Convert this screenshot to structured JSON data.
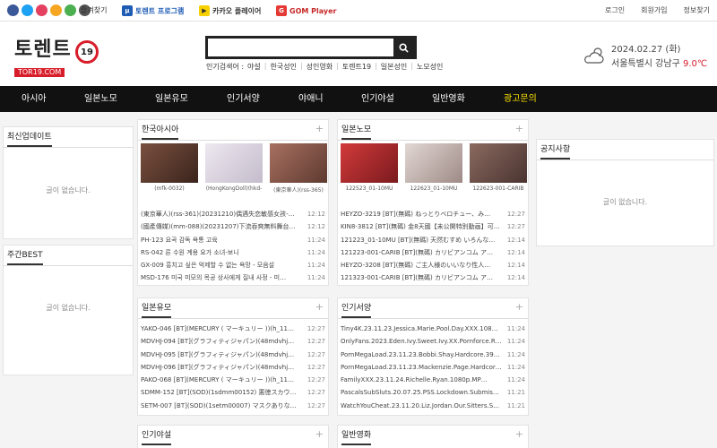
{
  "topbar": {
    "social_colors": [
      "#3b5998",
      "#1da1f2",
      "#e4405f",
      "#f5a623",
      "#4caf50",
      "#555555"
    ],
    "favorite": "즐겨찾기",
    "torrent_program": "토렌트 프로그램",
    "kakao_player": "카카오 플레이어",
    "gom_player": "GOM Player",
    "links": [
      "로그인",
      "회원가입",
      "정보찾기"
    ]
  },
  "header": {
    "logo_main": "토렌트",
    "logo_sub": "TOR19.COM",
    "logo_badge": "19",
    "search_placeholder": "",
    "keywords_label": "인기검색어 :",
    "keywords": [
      "야설",
      "한국성인",
      "성인영화",
      "토렌트19",
      "일본성인",
      "노모성인"
    ],
    "weather_date": "2024.02.27 (화)",
    "weather_location": "서울특별시 강남구",
    "weather_temp": "9.0℃"
  },
  "nav": [
    "아시아",
    "일본노모",
    "일본유모",
    "인기서양",
    "야애니",
    "인기야설",
    "일반영화",
    "광고문의"
  ],
  "left": {
    "latest_title": "최신업데이트",
    "latest_empty": "글이 없습니다.",
    "weekly_title": "주간BEST",
    "weekly_empty": "글이 없습니다."
  },
  "right": {
    "notice_title": "공지사항",
    "notice_empty": "글이 없습니다."
  },
  "sections": {
    "korea_asia": {
      "title": "한국아시아",
      "thumb_colors": [
        "#5a3b2e",
        "#d9d2dd",
        "#8a5a4b"
      ],
      "thumb_captions": [
        "(mfk-0032)",
        "(HongKongDoll)(hkd-",
        "(東京華人)(rss-365)"
      ],
      "items": [
        {
          "title": "(東京華人)(rss-361)(20231210)偶遇失恋敏感女孩-…",
          "time": "12:12"
        },
        {
          "title": "(國產傳媒)(mm-088)(20231207)下流吞爽無料舞台…",
          "time": "12:12"
        },
        {
          "title": "PH-123 요곡 감독 욕통 고육",
          "time": "11:24"
        },
        {
          "title": "RS-042 른 수원 계용 요가 소녀-보니",
          "time": "11:24"
        },
        {
          "title": "GX-009 흥치고 싶은 억제할 수 없는 욕망 - 모음설",
          "time": "11:24"
        },
        {
          "title": "MSD-176 미국 미모의 목공 상사에게 질내 사정 - 미…",
          "time": "11:24"
        }
      ]
    },
    "japan_nomo": {
      "title": "일본노모",
      "thumb_colors": [
        "#b3282e",
        "#c9c0bd",
        "#6a4f47"
      ],
      "thumb_captions": [
        "122523_01-10MU",
        "122623_01-10MU",
        "122623-001-CARIB"
      ],
      "items": [
        {
          "title": "HEYZO-3219 [BT](無碼) ねっとりベロチュー、み…",
          "time": "12:27"
        },
        {
          "title": "KIN8-3812 [BT](無碼) 金8天國【未公開特別動画】可…",
          "time": "12:27"
        },
        {
          "title": "121223_01-10MU [BT](無碼) 天然むすめ いろんな…",
          "time": "12:14"
        },
        {
          "title": "121223-001-CARIB [BT](無碼) カリビアンコム ア…",
          "time": "12:14"
        },
        {
          "title": "HEYZO-3208 [BT](無碼) ご主人様のいいなり性人…",
          "time": "12:14"
        },
        {
          "title": "121323-001-CARIB [BT](無碼) カリビアンコム ア…",
          "time": "12:14"
        }
      ]
    },
    "japan_yumo": {
      "title": "일본유모",
      "items": [
        {
          "title": "YAKO-046 [BT](MERCURY ( マーキュリー ))(h_11…",
          "time": "12:27"
        },
        {
          "title": "MDVHJ-094 [BT](グラフィティジャパン)(48mdvhj…",
          "time": "12:27"
        },
        {
          "title": "MDVHJ-095 [BT](グラフィティジャパン)(48mdvhj…",
          "time": "12:27"
        },
        {
          "title": "MDVHJ-096 [BT](グラフィティジャパン)(48mdvhj…",
          "time": "12:27"
        },
        {
          "title": "PAKO-068 [BT](MERCURY ( マーキュリー ))(h_11…",
          "time": "12:27"
        },
        {
          "title": "SDMM-152 [BT](SOD)(1sdmm00152) 悪徳スカウ…",
          "time": "12:27"
        },
        {
          "title": "SETM-007 [BT](SOD)(1setm00007) マスクありな…",
          "time": "12:27"
        }
      ]
    },
    "popular_western": {
      "title": "인기서양",
      "items": [
        {
          "title": "Tiny4K.23.11.23.Jessica.Marie.Pool.Day.XXX.1080…",
          "time": "11:24"
        },
        {
          "title": "OnlyFans.2023.Eden.Ivy.Sweet.Ivy.XX.Pornforce.R…",
          "time": "11:24"
        },
        {
          "title": "PornMegaLoad.23.11.23.Bobbi.Shay.Hardcore.398…",
          "time": "11:24"
        },
        {
          "title": "PornMegaLoad.23.11.23.Mackenzie.Page.Hardcor…",
          "time": "11:24"
        },
        {
          "title": "FamilyXXX.23.11.24.Richelle.Ryan.1080p.MP…",
          "time": "11:24"
        },
        {
          "title": "PascalsSubSluts.20.07.25.PSS.Lockdown.Submis…",
          "time": "11:21"
        },
        {
          "title": "WatchYouCheat.23.11.20.Liz.Jordan.Our.Sitters.Se…",
          "time": "11:21"
        }
      ]
    },
    "popular_yasul": {
      "title": "인기야설"
    },
    "general_movie": {
      "title": "일반영화"
    }
  }
}
